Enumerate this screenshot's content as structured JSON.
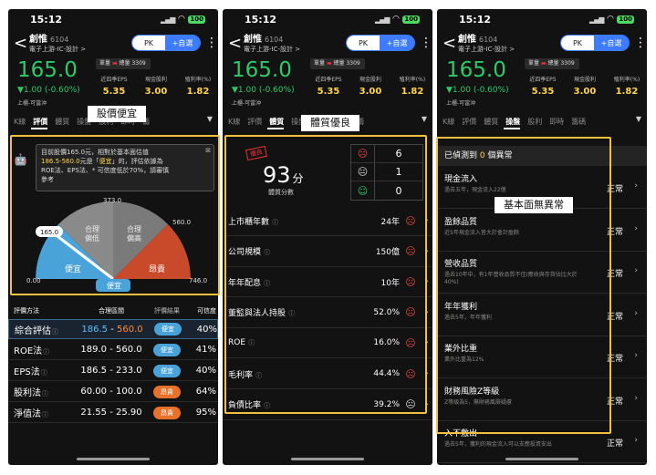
{
  "status": {
    "time": "15:12",
    "battery": "100"
  },
  "stock": {
    "name": "創惟",
    "code": "6104",
    "industry": "電子上游-IC-設計 >",
    "price": "165.0",
    "change": "▼1.00 (-0.60%)",
    "market": "上櫃-可當沖",
    "volume_label": "單量",
    "total_label": "總量 3309"
  },
  "header": {
    "pk_label": "PK",
    "add_label": "+自選",
    "more": "⋮",
    "back": "<"
  },
  "metrics": [
    {
      "label": "近四季EPS",
      "value": "5.35"
    },
    {
      "label": "現金股利",
      "value": "3.00"
    },
    {
      "label": "殖利率(%)",
      "value": "1.82"
    }
  ],
  "tabs": [
    {
      "label": "K線",
      "active": false
    },
    {
      "label": "評價",
      "active": true
    },
    {
      "label": "體質",
      "active": false
    },
    {
      "label": "操盤",
      "active": false
    },
    {
      "label": "股利",
      "active": false
    },
    {
      "label": "即時",
      "active": false
    },
    {
      "label": "籌",
      "active": false
    }
  ],
  "tabs2": [
    {
      "label": "K線",
      "active": false
    },
    {
      "label": "評價",
      "active": false
    },
    {
      "label": "體質",
      "active": true
    },
    {
      "label": "操盤",
      "active": false
    },
    {
      "label": "股利",
      "active": false
    },
    {
      "label": "即時",
      "active": false
    },
    {
      "label": "籌",
      "active": false
    }
  ],
  "tabs3": [
    {
      "label": "K線",
      "active": false
    },
    {
      "label": "評價",
      "active": false
    },
    {
      "label": "體質",
      "active": false
    },
    {
      "label": "操盤",
      "active": true
    },
    {
      "label": "股利",
      "active": false
    },
    {
      "label": "即時",
      "active": false
    },
    {
      "label": "籌碼",
      "active": false
    }
  ],
  "callouts": {
    "p1": "股價便宜",
    "p2": "體質優良",
    "p3": "基本面無異常"
  },
  "valuation": {
    "tip_line1": "目前股價165.0元，相對於基本面估值",
    "tip_range": "186.5-560.0",
    "tip_line2_pre": "元是「",
    "tip_hl": "便宜",
    "tip_line2_post": "」的，評估依據為",
    "tip_line3": "ROE法、EPS法、* 可信度低於70%，請審慎",
    "tip_line4": "參考",
    "gauge": {
      "min": "0.00",
      "low": "186.5",
      "mid": "373.0",
      "high": "560.0",
      "max": "746.0",
      "current": "165.0",
      "zones": [
        "便宜",
        "合理\n偏低",
        "合理\n偏高",
        "昂貴"
      ],
      "result": "便宜"
    },
    "columns": [
      "評價方法",
      "合理區間",
      "評價結果",
      "可信度"
    ],
    "rows": [
      {
        "method": "綜合評估",
        "low": "186.5",
        "high": "560.0",
        "result": "便宜",
        "conf": "40%",
        "sel": true
      },
      {
        "method": "ROE法",
        "low": "189.0",
        "high": "560.0",
        "result": "便宜",
        "conf": "41%",
        "sel": false
      },
      {
        "method": "EPS法",
        "low": "186.5",
        "high": "233.0",
        "result": "便宜",
        "conf": "40%",
        "sel": false
      },
      {
        "method": "股利法",
        "low": "60.00",
        "high": "100.0",
        "result": "昂貴",
        "conf": "64%",
        "sel": false
      },
      {
        "method": "淨值法",
        "low": "21.55",
        "high": "25.90",
        "result": "昂貴",
        "conf": "95%",
        "sel": false
      }
    ]
  },
  "quality": {
    "stamp": "優良",
    "score": "93",
    "score_unit": "分",
    "score_label": "體質分數",
    "counts": [
      {
        "face": "sad",
        "n": "6"
      },
      {
        "face": "neu",
        "n": "1"
      },
      {
        "face": "hap",
        "n": "0"
      }
    ],
    "rows": [
      {
        "label": "上市櫃年數",
        "value": "24年",
        "face": "sad"
      },
      {
        "label": "公司規模",
        "value": "150億",
        "face": "sad"
      },
      {
        "label": "年年配息",
        "value": "10年",
        "face": "sad"
      },
      {
        "label": "董監與法人持股",
        "value": "52.0%",
        "face": "sad"
      },
      {
        "label": "ROE",
        "value": "16.0%",
        "face": "sad"
      },
      {
        "label": "毛利率",
        "value": "44.4%",
        "face": "sad"
      },
      {
        "label": "負債比率",
        "value": "39.2%",
        "face": "neu"
      }
    ]
  },
  "fundamental": {
    "banner_pre": "已偵測到",
    "banner_count": "0",
    "banner_post": "個異常",
    "rows": [
      {
        "title": "現金流入",
        "desc": "過去五年，現金流入22億",
        "status": "正常"
      },
      {
        "title": "盈餘品質",
        "desc": "近5年現金流入皆大於會計盈餘",
        "status": "正常"
      },
      {
        "title": "營收品質",
        "desc": "過去10年中，有1年營收品質不佳(應收與存貨佔比大於40%)",
        "status": "正常"
      },
      {
        "title": "年年獲利",
        "desc": "過去5年，年年獲利",
        "status": "正常"
      },
      {
        "title": "業外比重",
        "desc": "業外比重為12%",
        "status": "正常"
      },
      {
        "title": "財務風險Z等級",
        "desc": "Z等級為5，無財務風險疑慮",
        "status": "正常"
      },
      {
        "title": "入不敷出",
        "desc": "過去5年，獲利的現金流入可以支應投資支出",
        "status": "正常"
      }
    ]
  },
  "colors": {
    "up": "#2ec96a",
    "accent": "#f0c040",
    "cheap": "#4aa3d8",
    "expensive": "#e8722a",
    "pk": "#3d7cff"
  }
}
